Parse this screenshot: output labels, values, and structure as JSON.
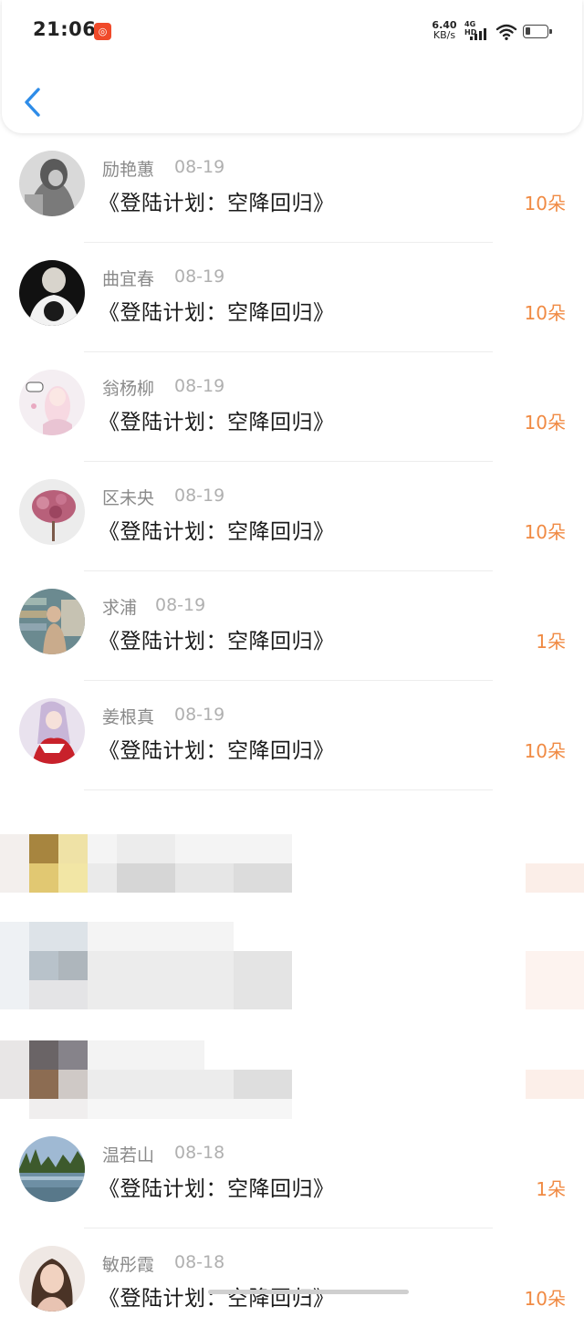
{
  "status_bar": {
    "time": "21:06",
    "app_badge_icon": "app-notification-icon",
    "net_speed_value": "6.40",
    "net_speed_unit": "KB/s",
    "network_type": "4G HD",
    "wifi_icon": "wifi-icon",
    "battery_icon": "battery-icon"
  },
  "header": {
    "back_icon": "chevron-left-icon",
    "accent_color": "#2e8ce8"
  },
  "colors": {
    "name": "#8a8a8a",
    "date": "#b0b0b0",
    "title": "#1a1a1a",
    "count": "#f08a43"
  },
  "items": [
    {
      "name": "励艳蕙",
      "date": "08-19",
      "title": "《登陆计划：空降回归》",
      "count": "10朵"
    },
    {
      "name": "曲宜春",
      "date": "08-19",
      "title": "《登陆计划：空降回归》",
      "count": "10朵"
    },
    {
      "name": "翁杨柳",
      "date": "08-19",
      "title": "《登陆计划：空降回归》",
      "count": "10朵"
    },
    {
      "name": "区未央",
      "date": "08-19",
      "title": "《登陆计划：空降回归》",
      "count": "10朵"
    },
    {
      "name": "求浦",
      "date": "08-19",
      "title": "《登陆计划：空降回归》",
      "count": "1朵"
    },
    {
      "name": "姜根真",
      "date": "08-19",
      "title": "《登陆计划：空降回归》",
      "count": "10朵"
    }
  ],
  "items_after": [
    {
      "name": "温若山",
      "date": "08-18",
      "title": "《登陆计划：空降回归》",
      "count": "1朵"
    },
    {
      "name": "敏彤霞",
      "date": "08-18",
      "title": "《登陆计划：空降回归》",
      "count": "10朵"
    }
  ]
}
